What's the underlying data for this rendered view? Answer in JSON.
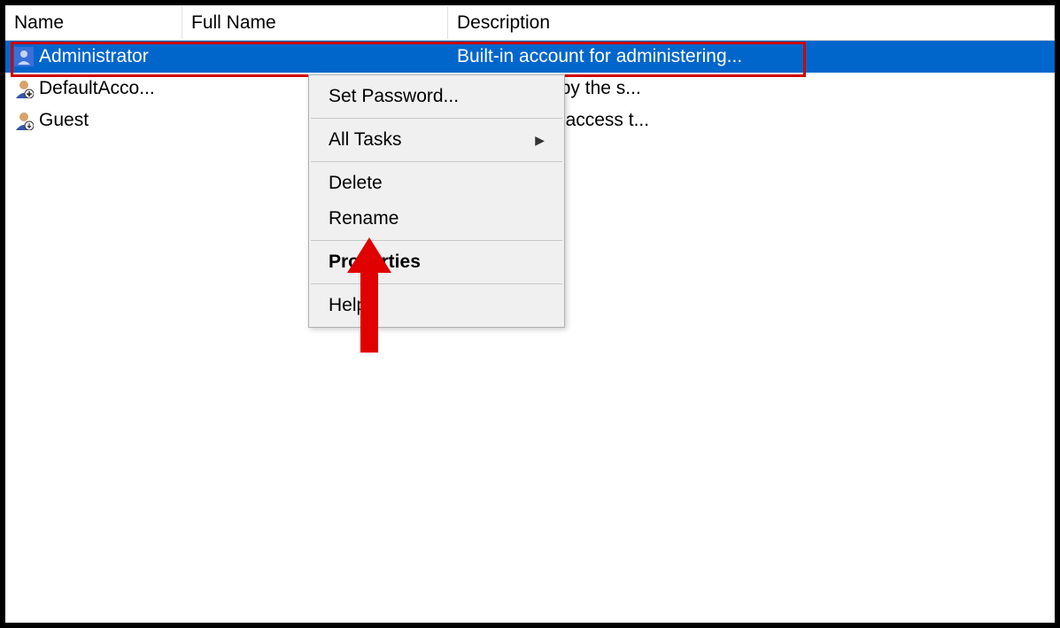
{
  "columns": {
    "name": "Name",
    "fullname": "Full Name",
    "description": "Description"
  },
  "rows": [
    {
      "name": "Administrator",
      "fullname": "",
      "description": "Built-in account for administering...",
      "selected": true,
      "iconSelected": true
    },
    {
      "name": "DefaultAcco...",
      "fullname": "",
      "description": "nt managed by the s...",
      "selected": false
    },
    {
      "name": "Guest",
      "fullname": "",
      "description": "unt for guest access t...",
      "selected": false
    }
  ],
  "contextMenu": {
    "setPassword": "Set Password...",
    "allTasks": "All Tasks",
    "delete": "Delete",
    "rename": "Rename",
    "properties": "Properties",
    "help": "Help"
  }
}
